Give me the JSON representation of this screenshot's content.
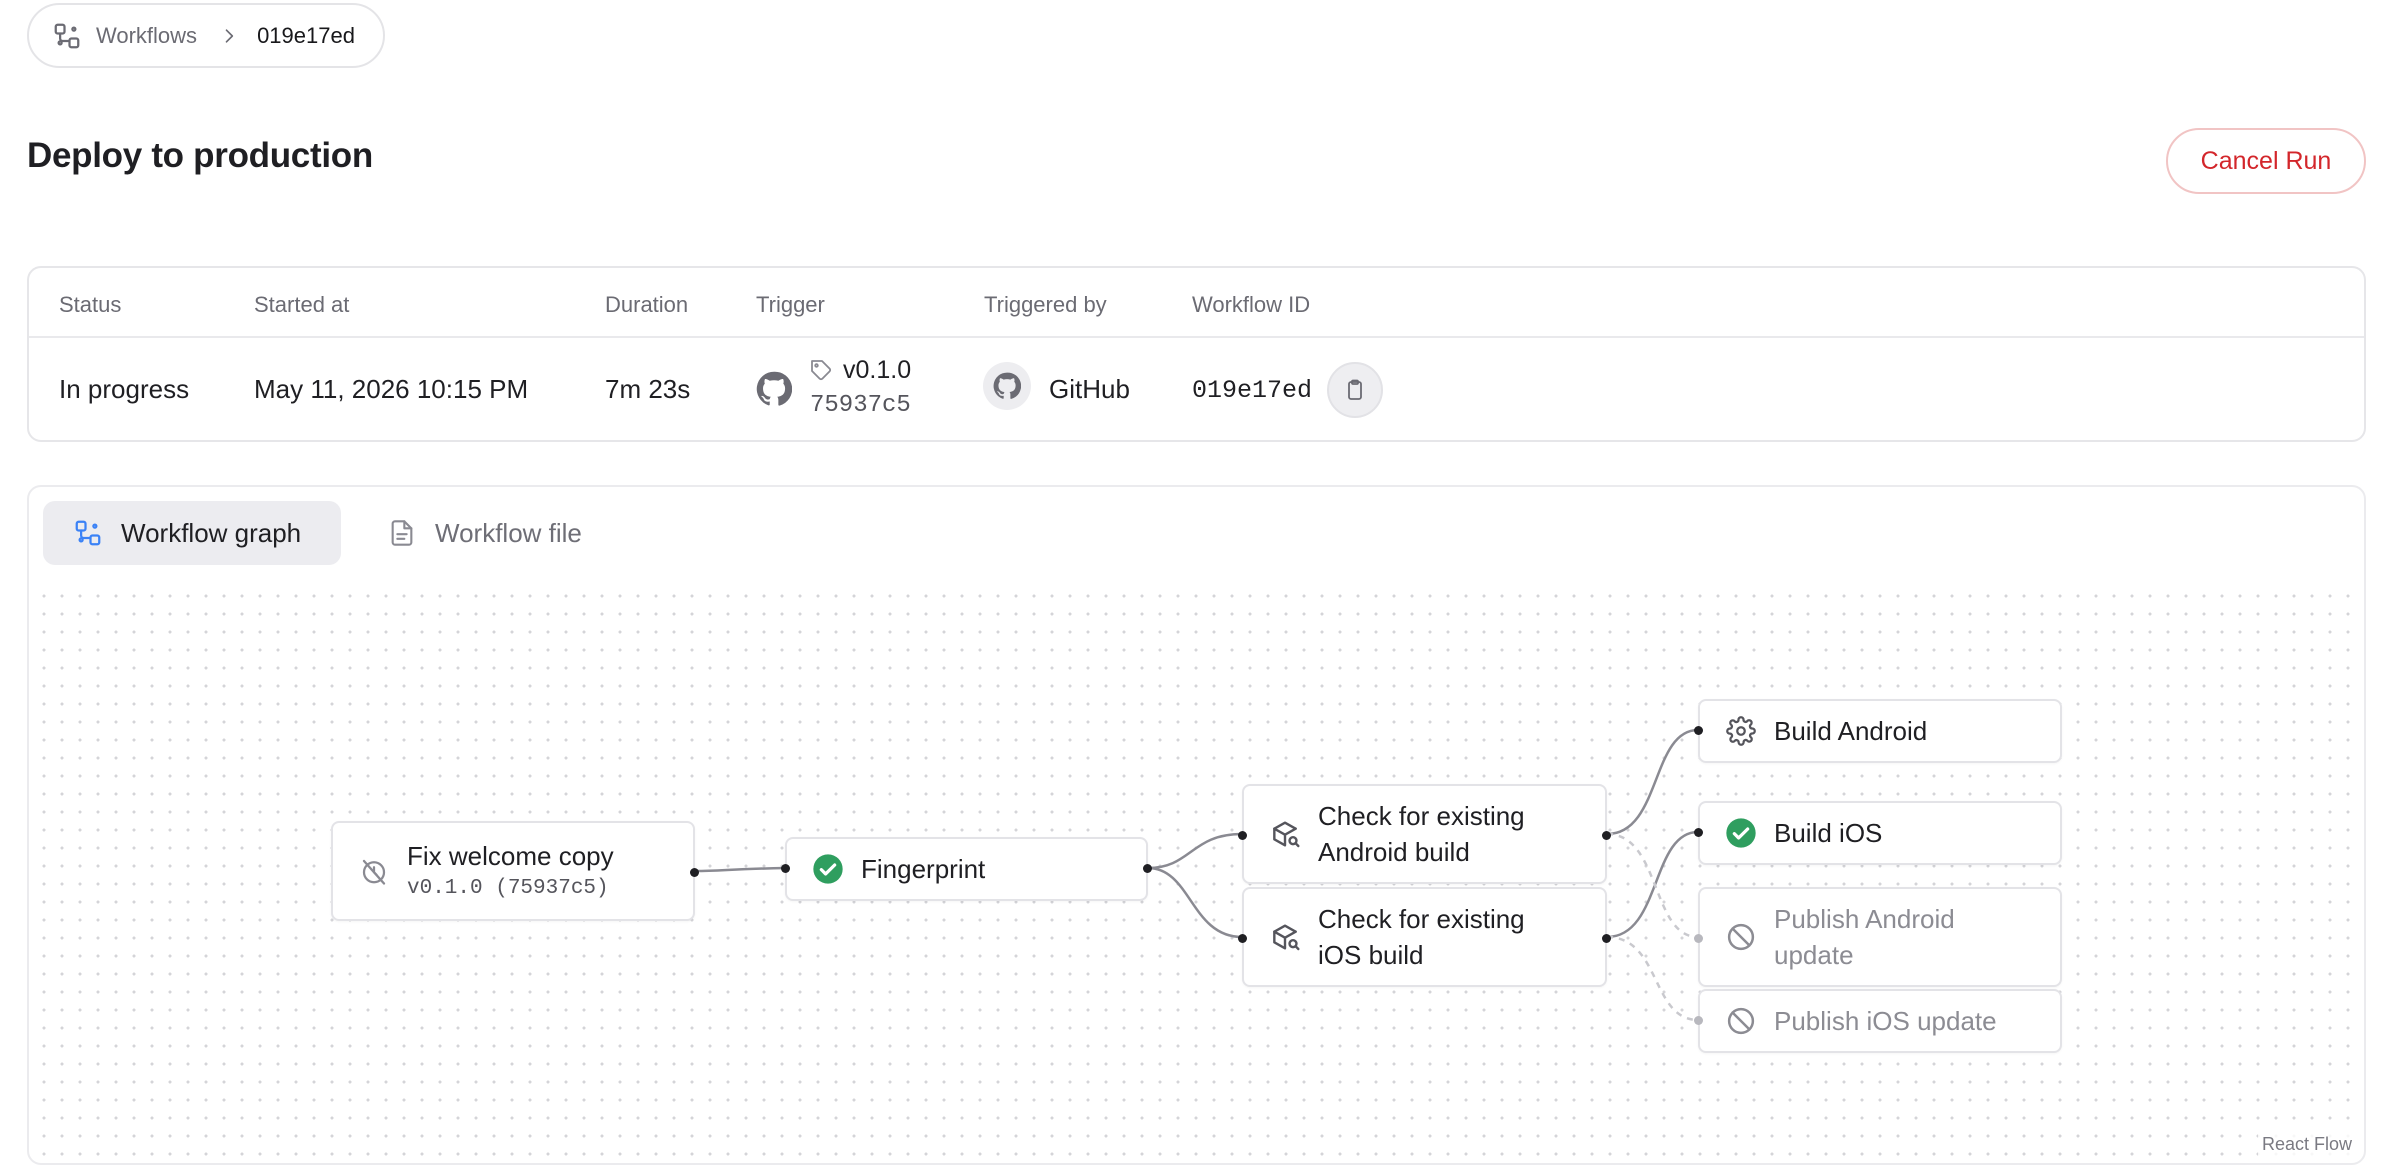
{
  "breadcrumb": {
    "parent": "Workflows",
    "current": "019e17ed"
  },
  "header": {
    "title": "Deploy to production",
    "cancel_label": "Cancel Run"
  },
  "run_info": {
    "columns": [
      "Status",
      "Started at",
      "Duration",
      "Trigger",
      "Triggered by",
      "Workflow ID"
    ],
    "status": "In progress",
    "started_at": "May 11, 2026 10:15 PM",
    "duration": "7m 23s",
    "trigger_tag": "v0.1.0",
    "trigger_commit": "75937c5",
    "triggered_by": "GitHub",
    "workflow_id": "019e17ed"
  },
  "tabs": {
    "graph": "Workflow graph",
    "file": "Workflow file"
  },
  "graph": {
    "attribution": "React Flow",
    "nodes": {
      "fix_copy": {
        "title": "Fix welcome copy",
        "subtitle": "v0.1.0 (75937c5)",
        "status": "pending"
      },
      "fingerprint": {
        "title": "Fingerprint",
        "status": "success"
      },
      "check_android": {
        "title_line1": "Check for existing",
        "title_line2": "Android build",
        "status": "running"
      },
      "check_ios": {
        "title_line1": "Check for existing",
        "title_line2": "iOS build",
        "status": "running"
      },
      "build_android": {
        "title": "Build Android",
        "status": "in-progress"
      },
      "build_ios": {
        "title": "Build iOS",
        "status": "success"
      },
      "publish_android": {
        "title_line1": "Publish Android",
        "title_line2": "update",
        "status": "skipped"
      },
      "publish_ios": {
        "title": "Publish iOS update",
        "status": "skipped"
      }
    }
  },
  "colors": {
    "success": "#2f9e5f",
    "danger": "#d3262b",
    "edge": "#8a8a92",
    "edge_muted": "#c9c9ce",
    "accent_icon": "#3b82f6"
  },
  "icons": {
    "breadcrumb": "workflow-icon",
    "tag": "tag-icon",
    "github": "github-icon",
    "copy": "clipboard-icon",
    "graph_tab": "workflow-icon",
    "file_tab": "file-text-icon",
    "pending": "timer-off-icon",
    "success": "check-circle-icon",
    "search_build": "package-search-icon",
    "gear": "gear-icon",
    "skipped": "ban-icon"
  }
}
